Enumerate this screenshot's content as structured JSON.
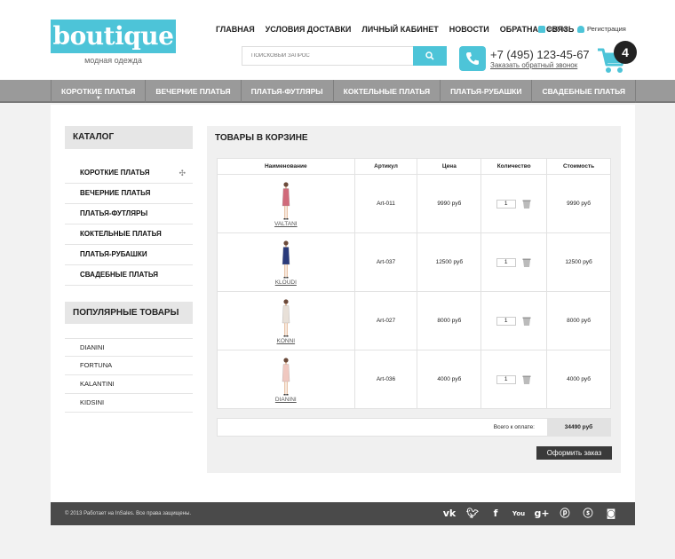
{
  "logo": {
    "text": "boutique",
    "subtitle": "модная одежда"
  },
  "top_nav": [
    "ГЛАВНАЯ",
    "УСЛОВИЯ ДОСТАВКИ",
    "ЛИЧНЫЙ КАБИНЕТ",
    "НОВОСТИ",
    "ОБРАТНАЯ СВЯЗЬ"
  ],
  "auth": {
    "login": "Войти",
    "register": "Регистрация"
  },
  "search": {
    "placeholder": "ПОИСКОВЫЙ ЗАПРОС"
  },
  "contact": {
    "phone": "+7 (495) 123-45-67",
    "callback": "Заказать обратный звонок"
  },
  "cart": {
    "count": "4"
  },
  "main_nav": [
    "КОРОТКИЕ ПЛАТЬЯ",
    "ВЕЧЕРНИЕ ПЛАТЬЯ",
    "ПЛАТЬЯ-ФУТЛЯРЫ",
    "КОКТЕЛЬНЫЕ ПЛАТЬЯ",
    "ПЛАТЬЯ-РУБАШКИ",
    "СВАДЕБНЫЕ ПЛАТЬЯ"
  ],
  "sidebar": {
    "catalog_title": "КАТАЛОГ",
    "catalog": [
      "КОРОТКИЕ ПЛАТЬЯ",
      "ВЕЧЕРНИЕ ПЛАТЬЯ",
      "ПЛАТЬЯ-ФУТЛЯРЫ",
      "КОКТЕЛЬНЫЕ ПЛАТЬЯ",
      "ПЛАТЬЯ-РУБАШКИ",
      "СВАДЕБНЫЕ ПЛАТЬЯ"
    ],
    "popular_title": "ПОПУЛЯРНЫЕ ТОВАРЫ",
    "popular": [
      "DIANINI",
      "FORTUNA",
      "KALANTINI",
      "KIDSINI"
    ]
  },
  "basket": {
    "title": "ТОВАРЫ В КОРЗИНЕ",
    "headers": [
      "Наименование",
      "Артикул",
      "Цена",
      "Количество",
      "Стоимость"
    ],
    "rows": [
      {
        "name": "VALTANI",
        "sku": "Art-011",
        "price": "9990 руб",
        "qty": "1",
        "total": "9990 руб",
        "color": "#d06a7a"
      },
      {
        "name": "KLOUDI",
        "sku": "Art-037",
        "price": "12500 руб",
        "qty": "1",
        "total": "12500 руб",
        "color": "#2a3a7a"
      },
      {
        "name": "KONNI",
        "sku": "Art-027",
        "price": "8000 руб",
        "qty": "1",
        "total": "8000 руб",
        "color": "#e8e0d8"
      },
      {
        "name": "DIANINI",
        "sku": "Art-036",
        "price": "4000 руб",
        "qty": "1",
        "total": "4000 руб",
        "color": "#f0c8c0"
      }
    ],
    "total_label": "Всего к оплате:",
    "total_value": "34490 руб",
    "order_button": "Оформить заказ"
  },
  "footer": {
    "copyright": "© 2013 Работает на InSales. Все права защищены.",
    "socials": [
      "vk-icon",
      "twitter-icon",
      "facebook-icon",
      "youtube-icon",
      "google-plus-icon",
      "pinterest-icon",
      "skype-icon",
      "instagram-icon"
    ]
  },
  "colors": {
    "accent": "#4dc4d8",
    "nav": "#9a9a9a",
    "footer": "#4a4a4a"
  }
}
